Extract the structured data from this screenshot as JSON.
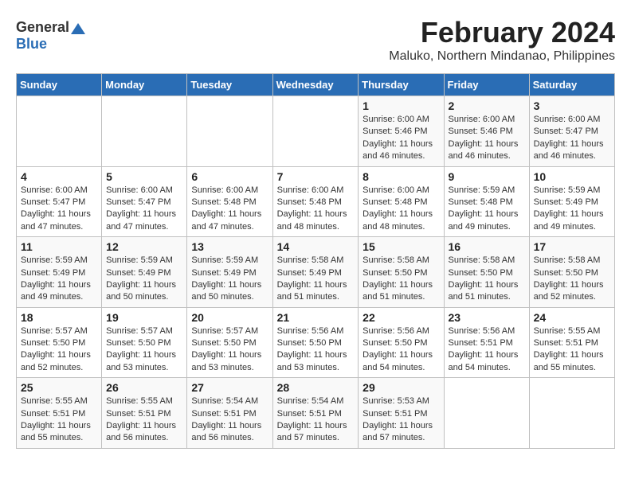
{
  "header": {
    "logo_general": "General",
    "logo_blue": "Blue",
    "month_year": "February 2024",
    "location": "Maluko, Northern Mindanao, Philippines"
  },
  "weekdays": [
    "Sunday",
    "Monday",
    "Tuesday",
    "Wednesday",
    "Thursday",
    "Friday",
    "Saturday"
  ],
  "weeks": [
    [
      {
        "day": "",
        "info": ""
      },
      {
        "day": "",
        "info": ""
      },
      {
        "day": "",
        "info": ""
      },
      {
        "day": "",
        "info": ""
      },
      {
        "day": "1",
        "info": "Sunrise: 6:00 AM\nSunset: 5:46 PM\nDaylight: 11 hours and 46 minutes."
      },
      {
        "day": "2",
        "info": "Sunrise: 6:00 AM\nSunset: 5:46 PM\nDaylight: 11 hours and 46 minutes."
      },
      {
        "day": "3",
        "info": "Sunrise: 6:00 AM\nSunset: 5:47 PM\nDaylight: 11 hours and 46 minutes."
      }
    ],
    [
      {
        "day": "4",
        "info": "Sunrise: 6:00 AM\nSunset: 5:47 PM\nDaylight: 11 hours and 47 minutes."
      },
      {
        "day": "5",
        "info": "Sunrise: 6:00 AM\nSunset: 5:47 PM\nDaylight: 11 hours and 47 minutes."
      },
      {
        "day": "6",
        "info": "Sunrise: 6:00 AM\nSunset: 5:48 PM\nDaylight: 11 hours and 47 minutes."
      },
      {
        "day": "7",
        "info": "Sunrise: 6:00 AM\nSunset: 5:48 PM\nDaylight: 11 hours and 48 minutes."
      },
      {
        "day": "8",
        "info": "Sunrise: 6:00 AM\nSunset: 5:48 PM\nDaylight: 11 hours and 48 minutes."
      },
      {
        "day": "9",
        "info": "Sunrise: 5:59 AM\nSunset: 5:48 PM\nDaylight: 11 hours and 49 minutes."
      },
      {
        "day": "10",
        "info": "Sunrise: 5:59 AM\nSunset: 5:49 PM\nDaylight: 11 hours and 49 minutes."
      }
    ],
    [
      {
        "day": "11",
        "info": "Sunrise: 5:59 AM\nSunset: 5:49 PM\nDaylight: 11 hours and 49 minutes."
      },
      {
        "day": "12",
        "info": "Sunrise: 5:59 AM\nSunset: 5:49 PM\nDaylight: 11 hours and 50 minutes."
      },
      {
        "day": "13",
        "info": "Sunrise: 5:59 AM\nSunset: 5:49 PM\nDaylight: 11 hours and 50 minutes."
      },
      {
        "day": "14",
        "info": "Sunrise: 5:58 AM\nSunset: 5:49 PM\nDaylight: 11 hours and 51 minutes."
      },
      {
        "day": "15",
        "info": "Sunrise: 5:58 AM\nSunset: 5:50 PM\nDaylight: 11 hours and 51 minutes."
      },
      {
        "day": "16",
        "info": "Sunrise: 5:58 AM\nSunset: 5:50 PM\nDaylight: 11 hours and 51 minutes."
      },
      {
        "day": "17",
        "info": "Sunrise: 5:58 AM\nSunset: 5:50 PM\nDaylight: 11 hours and 52 minutes."
      }
    ],
    [
      {
        "day": "18",
        "info": "Sunrise: 5:57 AM\nSunset: 5:50 PM\nDaylight: 11 hours and 52 minutes."
      },
      {
        "day": "19",
        "info": "Sunrise: 5:57 AM\nSunset: 5:50 PM\nDaylight: 11 hours and 53 minutes."
      },
      {
        "day": "20",
        "info": "Sunrise: 5:57 AM\nSunset: 5:50 PM\nDaylight: 11 hours and 53 minutes."
      },
      {
        "day": "21",
        "info": "Sunrise: 5:56 AM\nSunset: 5:50 PM\nDaylight: 11 hours and 53 minutes."
      },
      {
        "day": "22",
        "info": "Sunrise: 5:56 AM\nSunset: 5:50 PM\nDaylight: 11 hours and 54 minutes."
      },
      {
        "day": "23",
        "info": "Sunrise: 5:56 AM\nSunset: 5:51 PM\nDaylight: 11 hours and 54 minutes."
      },
      {
        "day": "24",
        "info": "Sunrise: 5:55 AM\nSunset: 5:51 PM\nDaylight: 11 hours and 55 minutes."
      }
    ],
    [
      {
        "day": "25",
        "info": "Sunrise: 5:55 AM\nSunset: 5:51 PM\nDaylight: 11 hours and 55 minutes."
      },
      {
        "day": "26",
        "info": "Sunrise: 5:55 AM\nSunset: 5:51 PM\nDaylight: 11 hours and 56 minutes."
      },
      {
        "day": "27",
        "info": "Sunrise: 5:54 AM\nSunset: 5:51 PM\nDaylight: 11 hours and 56 minutes."
      },
      {
        "day": "28",
        "info": "Sunrise: 5:54 AM\nSunset: 5:51 PM\nDaylight: 11 hours and 57 minutes."
      },
      {
        "day": "29",
        "info": "Sunrise: 5:53 AM\nSunset: 5:51 PM\nDaylight: 11 hours and 57 minutes."
      },
      {
        "day": "",
        "info": ""
      },
      {
        "day": "",
        "info": ""
      }
    ]
  ]
}
